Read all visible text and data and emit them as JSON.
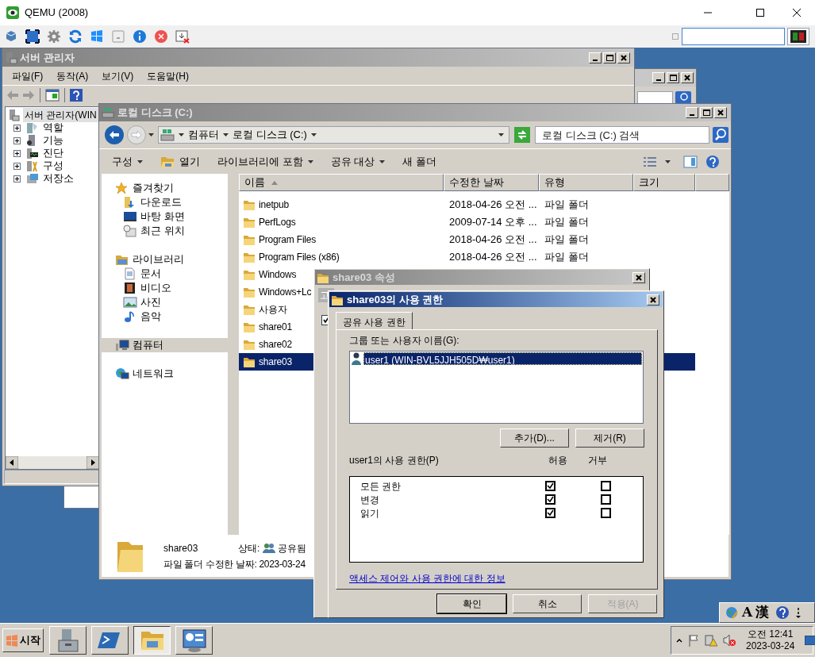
{
  "qemu": {
    "title": "QEMU (2008)"
  },
  "server_manager": {
    "title": "서버 관리자",
    "menu": [
      "파일(F)",
      "동작(A)",
      "보기(V)",
      "도움말(H)"
    ],
    "tree": {
      "label": "서버 관리자(WIN",
      "selected": true,
      "children": [
        {
          "label": "역할",
          "expanded": false,
          "selected": false
        },
        {
          "label": "기능",
          "expanded": false,
          "selected": false
        },
        {
          "label": "진단",
          "expanded": false,
          "selected": false
        },
        {
          "label": "구성",
          "expanded": false,
          "selected": false
        },
        {
          "label": "저장소",
          "expanded": false,
          "selected": false
        }
      ]
    }
  },
  "explorer": {
    "title": "로컬 디스크 (C:)",
    "breadcrumb": [
      "컴퓨터",
      "로컬 디스크 (C:)"
    ],
    "search_placeholder": "로컬 디스크 (C:) 검색",
    "commands": [
      {
        "label": "구성",
        "kind": "plain",
        "dropdown": true
      },
      {
        "label": "열기",
        "kind": "open",
        "dropdown": false
      },
      {
        "label": "라이브러리에 포함",
        "kind": "plain",
        "dropdown": true
      },
      {
        "label": "공유 대상",
        "kind": "plain",
        "dropdown": true
      },
      {
        "label": "새 폴더",
        "kind": "plain",
        "dropdown": false
      }
    ],
    "nav": [
      {
        "label": "즐겨찾기",
        "kind": "star",
        "selected": false,
        "children": [
          {
            "label": "다운로드",
            "kind": "download",
            "selected": false
          },
          {
            "label": "바탕 화면",
            "kind": "desktop",
            "selected": false
          },
          {
            "label": "최근 위치",
            "kind": "recent",
            "selected": false
          }
        ]
      },
      {
        "label": "라이브러리",
        "kind": "library",
        "selected": false,
        "children": [
          {
            "label": "문서",
            "kind": "document",
            "selected": false
          },
          {
            "label": "비디오",
            "kind": "video",
            "selected": false
          },
          {
            "label": "사진",
            "kind": "photo",
            "selected": false
          },
          {
            "label": "음악",
            "kind": "music",
            "selected": false
          }
        ]
      },
      {
        "label": "컴퓨터",
        "kind": "computer",
        "selected": true
      },
      {
        "label": "네트워크",
        "kind": "network",
        "selected": false
      }
    ],
    "columns": [
      {
        "label": "이름",
        "sorted": true
      },
      {
        "label": "수정한 날짜",
        "sorted": false
      },
      {
        "label": "유형",
        "sorted": false
      },
      {
        "label": "크기",
        "sorted": false
      }
    ],
    "rows": [
      {
        "name": "inetpub",
        "modified": "2018-04-26 오전 ...",
        "type": "파일 폴더",
        "selected": false
      },
      {
        "name": "PerfLogs",
        "modified": "2009-07-14 오후 ...",
        "type": "파일 폴더",
        "selected": false
      },
      {
        "name": "Program Files",
        "modified": "2018-04-26 오전 ...",
        "type": "파일 폴더",
        "selected": false
      },
      {
        "name": "Program Files (x86)",
        "modified": "2018-04-26 오전 ...",
        "type": "파일 폴더",
        "selected": false
      },
      {
        "name": "Windows",
        "selected": false
      },
      {
        "name": "Windows+Lc",
        "selected": false
      },
      {
        "name": "사용자",
        "selected": false
      },
      {
        "name": "share01",
        "selected": false
      },
      {
        "name": "share02",
        "selected": false
      },
      {
        "name": "share03",
        "selected": true
      }
    ],
    "details": {
      "name": "share03",
      "type": "파일 폴더",
      "status_label": "상태:",
      "status": "공유됨",
      "modified_label": "수정한 날짜:",
      "modified": "2023-03-24"
    }
  },
  "properties_dialog": {
    "title": "share03 속성",
    "tab": "고",
    "checkbox": {
      "checked": true
    }
  },
  "permissions_dialog": {
    "title": "share03의 사용 권한",
    "tab": "공유 사용 권한",
    "users_label": "그룹 또는 사용자 이름(G):",
    "users": [
      {
        "name": "user1 (WIN-BVL5JJH505D₩user1)",
        "selected": true
      }
    ],
    "add_button": "추가(D)...",
    "remove_button": "제거(R)",
    "permissions_label": "user1의 사용 권한(P)",
    "allow_header": "허용",
    "deny_header": "거부",
    "permissions": [
      {
        "name": "모든 권한",
        "allow": true,
        "deny": false
      },
      {
        "name": "변경",
        "allow": true,
        "deny": false
      },
      {
        "name": "읽기",
        "allow": true,
        "deny": false
      }
    ],
    "link": "액세스 제어와 사용 권한에 대한 정보",
    "buttons": [
      {
        "label": "확인",
        "default": true,
        "disabled": false
      },
      {
        "label": "취소",
        "default": false,
        "disabled": false
      },
      {
        "label": "적용(A)",
        "default": false,
        "disabled": true
      }
    ]
  },
  "language_bar": {
    "items": [
      "A",
      "漢"
    ]
  },
  "taskbar": {
    "start": "시작",
    "tasks": [
      {
        "kind": "server",
        "selected": false
      },
      {
        "kind": "powershell",
        "selected": false
      },
      {
        "kind": "explorer",
        "selected": true
      },
      {
        "kind": "panel",
        "selected": false
      }
    ],
    "clock_time": "오전 12:41",
    "clock_date": "2023-03-24"
  }
}
